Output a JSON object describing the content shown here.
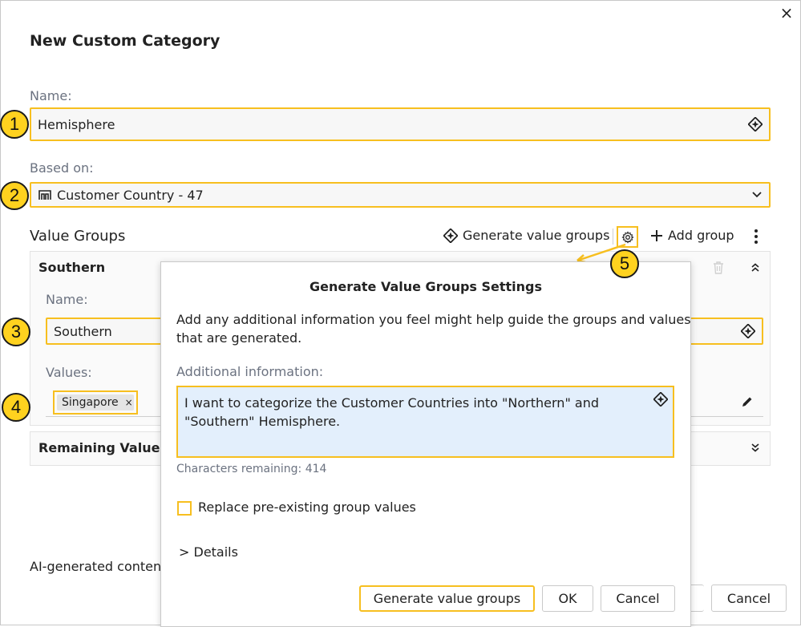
{
  "dialog": {
    "title": "New Custom Category",
    "close_glyph": "×",
    "name_label": "Name:",
    "name_value": "Hemisphere",
    "based_on_label": "Based on:",
    "based_on_value": "Customer Country - 47",
    "value_groups_label": "Value Groups",
    "generate_value_groups": "Generate value groups",
    "add_group": "Add group",
    "ai_disclaimer": "AI-generated conten",
    "cancel_label": "Cancel"
  },
  "groups": [
    {
      "title": "Southern",
      "name_label": "Name:",
      "name_value": "Southern",
      "values_label": "Values:",
      "values": [
        "Singapore"
      ]
    }
  ],
  "remaining_values_label": "Remaining Values",
  "markers": [
    "1",
    "2",
    "3",
    "4",
    "5"
  ],
  "modal": {
    "title": "Generate Value Groups Settings",
    "intro_line1": "Add any additional information you feel might help guide the groups and values",
    "intro_line2": "that are generated.",
    "additional_info_label": "Additional information:",
    "additional_info_line1": "I want to categorize the Customer Countries into \"Northern\" and",
    "additional_info_line2": "\"Southern\" Hemisphere.",
    "characters_remaining": "Characters remaining: 414",
    "replace_checkbox_label": "Replace pre-existing group values",
    "details_label": "> Details",
    "generate_button": "Generate value groups",
    "ok_button": "OK",
    "cancel_button": "Cancel"
  },
  "colors": {
    "highlight": "#f7bf1f",
    "marker_fill": "#ffd21f",
    "textarea_bg": "#e3effc"
  },
  "icons": [
    "close-icon",
    "ai-sparkle-icon",
    "table-icon",
    "chevron-down-icon",
    "gear-icon",
    "plus-icon",
    "more-vertical-icon",
    "trash-icon",
    "chevron-up-icon",
    "pencil-icon",
    "chevron-double-down-icon"
  ]
}
